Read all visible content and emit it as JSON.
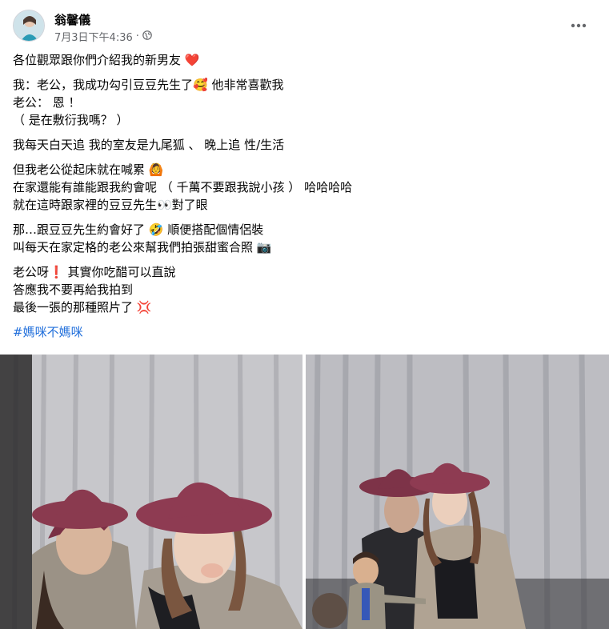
{
  "post": {
    "author": "翁馨儀",
    "timestamp": "7月3日下午4:36",
    "separator": "·",
    "audience_icon": "globe-icon",
    "more_icon": "more-horizontal-icon",
    "paragraphs": [
      [
        "各位觀眾跟你們介紹我的新男友 ❤️"
      ],
      [
        "我：老公，我成功勾引豆豆先生了🥰 他非常喜歡我",
        "老公： 恩 ！",
        "（ 是在敷衍我嗎？ ）"
      ],
      [
        "我每天白天追 我的室友是九尾狐 、 晚上追 性/生活"
      ],
      [
        "但我老公從起床就在喊累 🙆",
        "在家還能有誰能跟我約會呢 （ 千萬不要跟我說小孩 ） 哈哈哈哈",
        "就在這時跟家裡的豆豆先生👀對了眼"
      ],
      [
        "那…跟豆豆先生約會好了 🤣 順便搭配個情侶裝",
        "叫每天在家定格的老公來幫我們拍張甜蜜合照 📷"
      ],
      [
        "老公呀❗ 其實你吃醋可以直說",
        "答應我不要再給我拍到",
        "最後一張的那種照片了 💢"
      ]
    ],
    "hashtag": "#媽咪不媽咪",
    "photos": [
      {
        "name": "photo-1",
        "icon": "selfie-two-hats-photo"
      },
      {
        "name": "photo-2",
        "icon": "couple-with-doll-photo"
      }
    ]
  },
  "colors": {
    "text": "#050505",
    "secondary": "#65676b",
    "link": "#216fdb",
    "curtain": "#c9c9cd",
    "hat": "#8a3a4f",
    "background": "#ffffff"
  }
}
